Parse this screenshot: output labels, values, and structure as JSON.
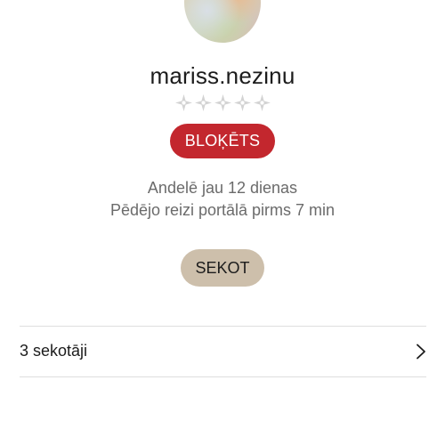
{
  "profile": {
    "username": "mariss.nezinu",
    "rating": 0,
    "rating_max": 5,
    "badge": "BLOĶĒTS",
    "selling_since": "Andelē jau 12 dienas",
    "last_seen": "Pēdējo reizi portālā pirms 7 min",
    "follow_label": "SEKOT",
    "followers_label": "3 sekotāji"
  },
  "colors": {
    "badge_bg": "#c3272e",
    "follow_bg": "#cdbfab",
    "star_empty": "#d3d3d3"
  },
  "icons": {
    "rating_star": "diamond-star-icon",
    "followers_chevron": "chevron-right-icon"
  }
}
